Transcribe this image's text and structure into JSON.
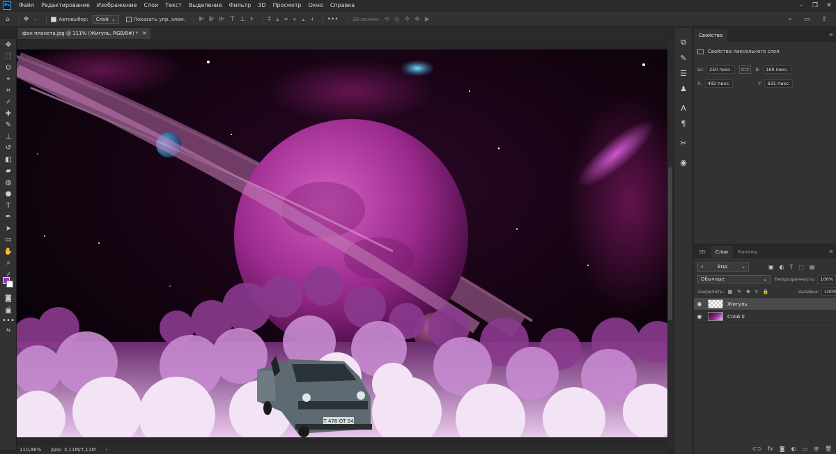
{
  "app_icon": "Ps",
  "menu": [
    "Файл",
    "Редактирование",
    "Изображение",
    "Слои",
    "Текст",
    "Выделение",
    "Фильтр",
    "3D",
    "Просмотр",
    "Окно",
    "Справка"
  ],
  "options": {
    "autoselect_label": "Автовыбор:",
    "autoselect_value": "Слой",
    "show_controls_label": "Показать упр. элем.",
    "mode_3d_label": "3D-режим:"
  },
  "document_tab": "фон планета.jpg @ 111% (Жигуль, RGB/8#) *",
  "colors": {
    "foreground": "#9c2ed6",
    "background": "#ffffff"
  },
  "status": {
    "zoom": "110,86%",
    "doc": "Док: 3,11M/7,11M"
  },
  "properties": {
    "tab": "Свойства",
    "subtitle": "Свойства пиксельного слоя",
    "w_label": "Ш:",
    "w_value": "250 пикс.",
    "h_label": "В:",
    "h_value": "169 пикс.",
    "x_label": "X:",
    "x_value": "492 пикс.",
    "y_label": "Y:",
    "y_value": "631 пикс."
  },
  "layers_panel": {
    "tabs": [
      "3D",
      "Слои",
      "Каналы"
    ],
    "filter_value": "Вид",
    "blend_mode": "Обычные",
    "opacity_label": "Непрозрачность:",
    "opacity_value": "100%",
    "lock_label": "Закрепить:",
    "fill_label": "Заливка:",
    "fill_value": "100%",
    "layers": [
      {
        "name": "Жигуль",
        "selected": true
      },
      {
        "name": "Слой 0",
        "selected": false
      }
    ]
  },
  "car_plate": "Т 478 ОТ 54"
}
